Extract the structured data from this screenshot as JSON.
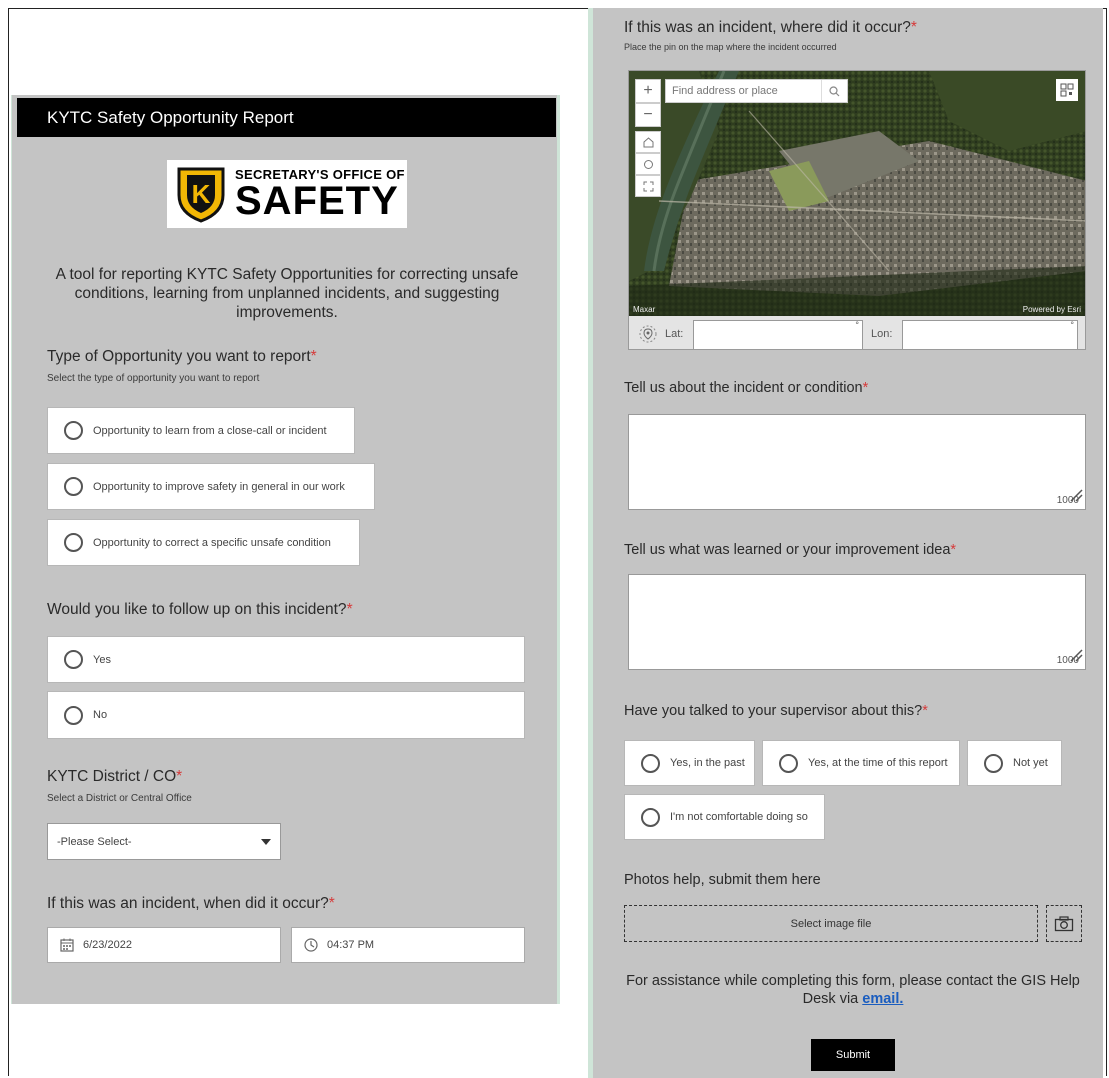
{
  "left": {
    "header_title": "KYTC Safety Opportunity Report",
    "logo": {
      "line1": "SECRETARY'S OFFICE OF",
      "line2": "SAFETY",
      "shield_letter": "K"
    },
    "intro": "A tool for reporting KYTC Safety Opportunities for correcting unsafe conditions, learning from unplanned incidents, and suggesting improvements.",
    "q_type": {
      "label": "Type of Opportunity you want to report",
      "hint": "Select the type of opportunity you want to report",
      "options": [
        "Opportunity to learn from a close-call or incident",
        "Opportunity to improve safety in general in our work",
        "Opportunity to correct a specific unsafe condition"
      ]
    },
    "q_followup": {
      "label": "Would you like to follow up on this incident?",
      "options": [
        "Yes",
        "No"
      ]
    },
    "q_district": {
      "label": "KYTC District / CO",
      "hint": "Select a District or Central Office",
      "selected": "-Please Select-"
    },
    "q_when": {
      "label": "If this was an incident, when did it occur?",
      "date": "6/23/2022",
      "time": "04:37 PM"
    }
  },
  "right": {
    "q_where": {
      "label": "If this was an incident, where did it occur?",
      "hint": "Place the pin on the map where the incident occurred",
      "search_placeholder": "Find address or place",
      "attribution_left": "Maxar",
      "attribution_right": "Powered by Esri",
      "lat_label": "Lat:",
      "lon_label": "Lon:",
      "degree": "°"
    },
    "q_tell": {
      "label": "Tell us about the incident or condition",
      "count": "1000"
    },
    "q_learned": {
      "label": "Tell us what was learned or your improvement idea",
      "count": "1000"
    },
    "q_supervisor": {
      "label": "Have you talked to your supervisor about this?",
      "options": [
        "Yes, in the past",
        "Yes, at the time of this report",
        "Not yet",
        "I'm not comfortable doing so"
      ]
    },
    "photos": {
      "label": "Photos help, submit them here",
      "button": "Select image file"
    },
    "assist": {
      "text": "For assistance while completing this form, please contact the GIS Help Desk via ",
      "link": "email."
    },
    "submit": "Submit"
  },
  "required_mark": "*",
  "colors": {
    "required": "#d63a3a",
    "panel": "#c4c4c4",
    "header": "#000000",
    "link": "#1a5dbf"
  }
}
